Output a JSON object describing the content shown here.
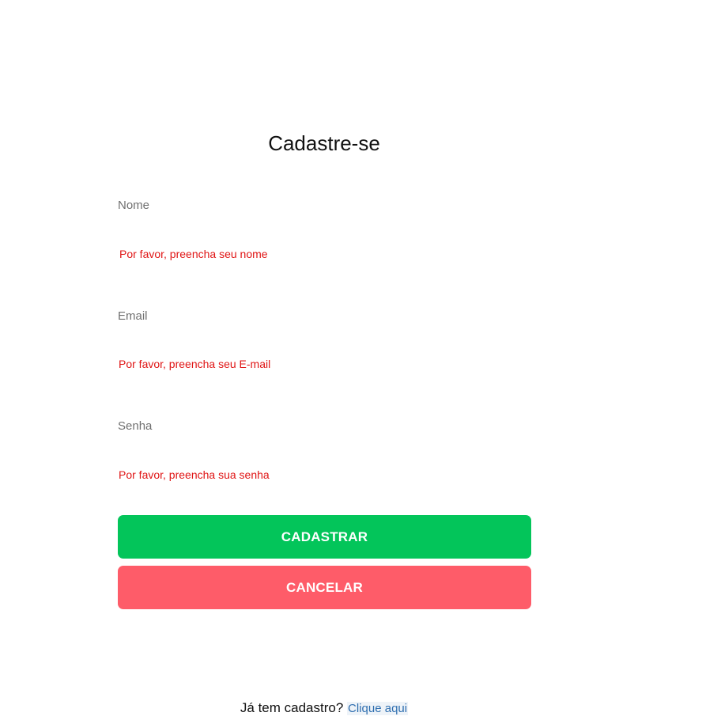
{
  "header": {
    "title": "Cadastre-se"
  },
  "form": {
    "name": {
      "label": "Nome",
      "value": "",
      "error": "Por favor, preencha seu nome"
    },
    "email": {
      "label": "Email",
      "value": "",
      "error": "Por favor, preencha seu E-mail"
    },
    "password": {
      "label": "Senha",
      "value": "",
      "error": "Por favor, preencha sua senha"
    }
  },
  "actions": {
    "register_label": "CADASTRAR",
    "cancel_label": "CANCELAR"
  },
  "footer": {
    "prompt": "Já tem cadastro?",
    "link_label": "Clique aqui"
  },
  "colors": {
    "register_button": "#03c55a",
    "cancel_button": "#fe5c69",
    "error_text": "#e01515",
    "link": "#2f6fb0"
  }
}
